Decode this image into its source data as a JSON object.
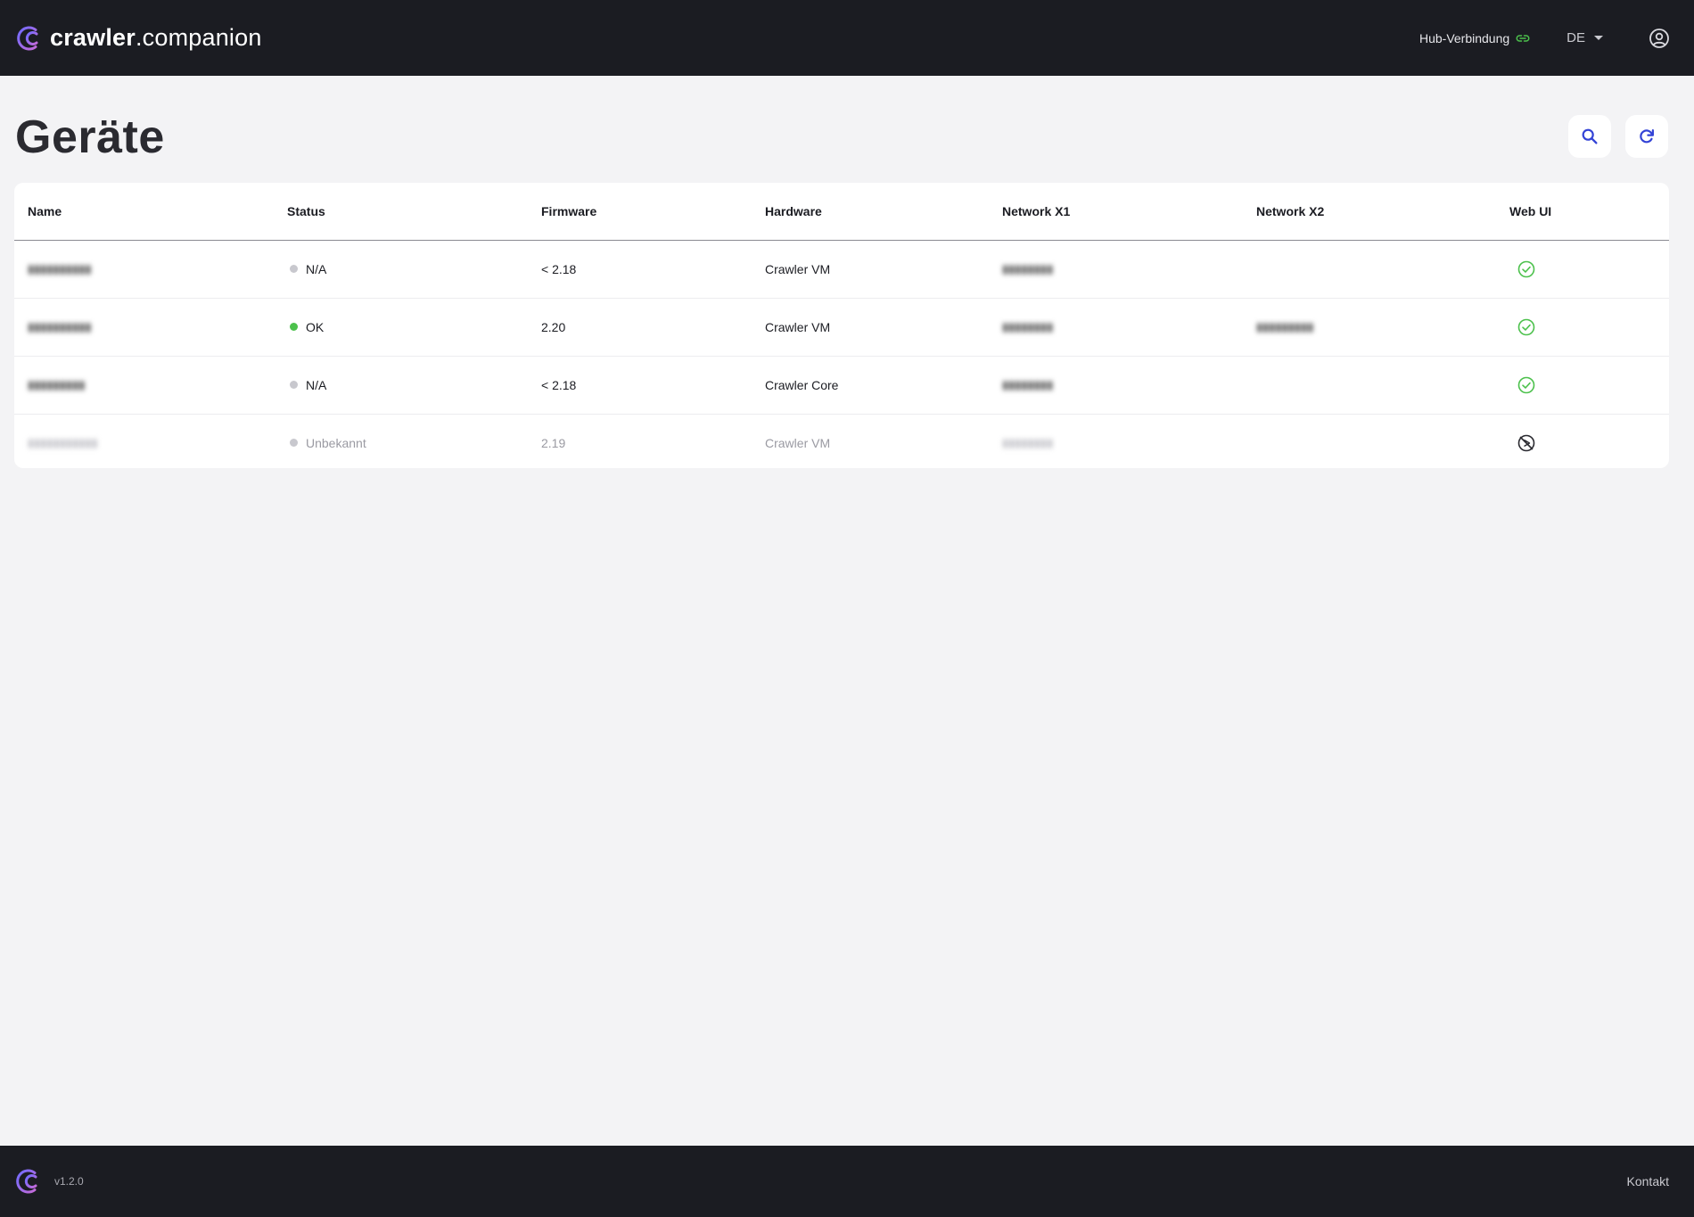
{
  "app": {
    "brand_bold": "crawler",
    "brand_light": ".companion",
    "logo_icon": "crawler-logo-icon"
  },
  "header": {
    "hub_connection_label": "Hub-Verbindung",
    "hub_icon": "link-icon",
    "hub_status_color": "#4cc14c",
    "language": "DE",
    "account_icon": "user-circle-icon"
  },
  "page": {
    "title": "Geräte",
    "search_icon": "search-icon",
    "refresh_icon": "refresh-icon"
  },
  "table": {
    "headers": {
      "name": "Name",
      "status": "Status",
      "firmware": "Firmware",
      "hardware": "Hardware",
      "network_x1": "Network X1",
      "network_x2": "Network X2",
      "web_ui": "Web UI"
    },
    "rows": [
      {
        "name": "redacted",
        "status": "N/A",
        "status_color": "#c8c8ce",
        "firmware": "< 2.18",
        "hardware": "Crawler VM",
        "network_x1": "redacted",
        "network_x2": "",
        "web_ui": "available",
        "web_ui_icon": "check-circle-icon"
      },
      {
        "name": "redacted",
        "status": "OK",
        "status_color": "#4cc14c",
        "firmware": "2.20",
        "hardware": "Crawler VM",
        "network_x1": "redacted",
        "network_x2": "redacted",
        "web_ui": "available",
        "web_ui_icon": "check-circle-icon"
      },
      {
        "name": "redacted",
        "status": "N/A",
        "status_color": "#c8c8ce",
        "firmware": "< 2.18",
        "hardware": "Crawler Core",
        "network_x1": "redacted",
        "network_x2": "",
        "web_ui": "available",
        "web_ui_icon": "check-circle-icon"
      },
      {
        "name": "redacted",
        "status": "Unbekannt",
        "status_color": "#c8c8ce",
        "firmware": "2.19",
        "hardware": "Crawler VM",
        "network_x1": "redacted",
        "network_x2": "",
        "web_ui": "unavailable",
        "web_ui_icon": "web-ui-offline-icon"
      }
    ]
  },
  "footer": {
    "version": "v1.2.0",
    "contact_label": "Kontakt"
  },
  "colors": {
    "bar_bg": "#1b1c22",
    "page_bg": "#f3f3f5",
    "accent_blue": "#3343d6",
    "logo_gradient_start": "#7b5cff",
    "logo_gradient_end": "#c46ad8",
    "success_green": "#4cc14c"
  }
}
